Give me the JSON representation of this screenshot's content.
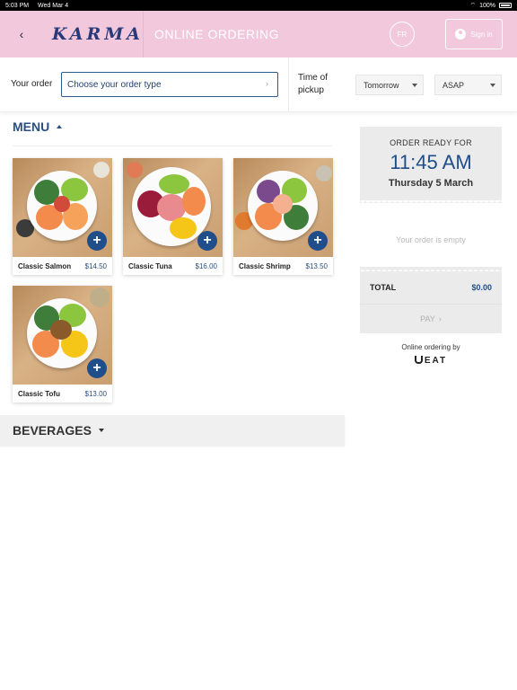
{
  "status_bar": {
    "time": "5:03 PM",
    "date": "Wed Mar 4",
    "battery": "100%"
  },
  "header": {
    "logo": "KARMA",
    "title": "ONLINE ORDERING",
    "language": "FR",
    "signin": "Sign in"
  },
  "order_bar": {
    "your_order_label": "Your order",
    "order_type_placeholder": "Choose your order type",
    "time_of_pickup_label": "Time of pickup",
    "day_value": "Tomorrow",
    "time_value": "ASAP"
  },
  "menu": {
    "heading": "MENU",
    "items": [
      {
        "name": "Classic Salmon",
        "price": "$14.50"
      },
      {
        "name": "Classic Tuna",
        "price": "$16.00"
      },
      {
        "name": "Classic Shrimp",
        "price": "$13.50"
      },
      {
        "name": "Classic Tofu",
        "price": "$13.00"
      }
    ]
  },
  "beverages": {
    "heading": "BEVERAGES"
  },
  "cart": {
    "ready_label": "ORDER READY FOR",
    "ready_time": "11:45 AM",
    "ready_date": "Thursday 5 March",
    "empty_text": "Your order is empty",
    "total_label": "TOTAL",
    "total_value": "$0.00",
    "pay_label": "PAY",
    "powered_by": "Online ordering by",
    "powered_brand": "EAT"
  },
  "colors": {
    "header_bg": "#f2c8dd",
    "accent": "#1f4e8a",
    "panel_bg": "#ebebeb"
  }
}
